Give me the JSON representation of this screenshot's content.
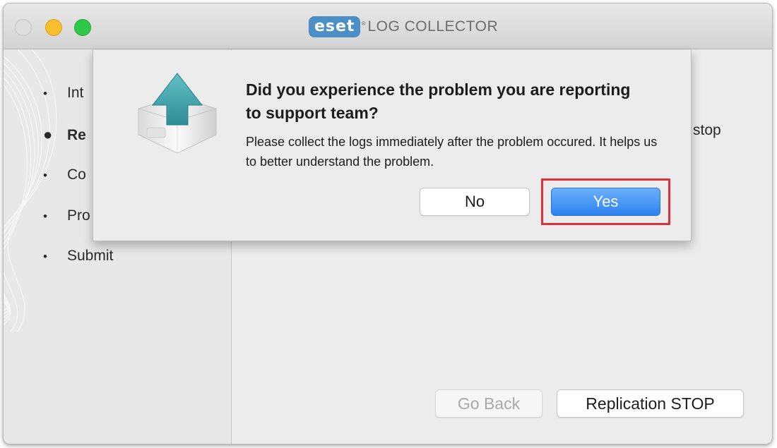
{
  "window": {
    "logo": "eset",
    "title": "LOG COLLECTOR"
  },
  "sidebar": {
    "steps": [
      {
        "label": "Int",
        "active": false
      },
      {
        "label": "Re",
        "active": true
      },
      {
        "label": "Co",
        "active": false
      },
      {
        "label": "Pro",
        "active": false
      },
      {
        "label": "Submit",
        "active": false
      }
    ]
  },
  "main": {
    "partial_text": "stop",
    "go_back_label": "Go Back",
    "replication_stop_label": "Replication STOP"
  },
  "dialog": {
    "icon": "upload-arrow-box-icon",
    "title": "Did you experience the problem you are reporting to support team?",
    "message": "Please collect the logs immediately after the problem occured. It helps us to better understand the problem.",
    "no_label": "No",
    "yes_label": "Yes"
  },
  "colors": {
    "accent": "#3d8ef6",
    "highlight": "#e0303c",
    "brand": "#4b8fc6"
  }
}
